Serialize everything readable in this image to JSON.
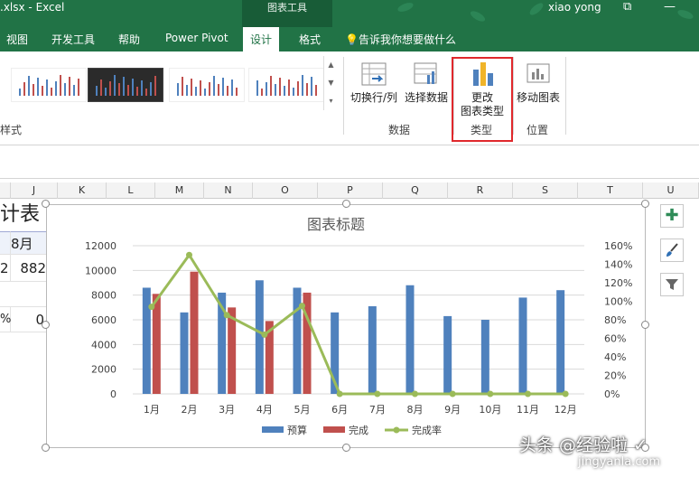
{
  "titlebar": {
    "file_title": ".xlsx  -  Excel",
    "context_tools": "图表工具",
    "user": "xiao yong",
    "restore_glyph": "⧉",
    "minimize_glyph": "—"
  },
  "tabs": [
    "视图",
    "开发工具",
    "帮助",
    "Power Pivot",
    "设计",
    "格式"
  ],
  "active_tab": "设计",
  "tell_me": "告诉我你想要做什么",
  "ribbon": {
    "styles_group_label": "样式",
    "buttons": {
      "switch_row_col": "切换行/列",
      "select_data": "选择数据",
      "change_chart_type_line1": "更改",
      "change_chart_type_line2": "图表类型",
      "move_chart": "移动图表"
    },
    "groups": {
      "data": "数据",
      "type": "类型",
      "location": "位置"
    }
  },
  "columns": [
    "J",
    "K",
    "L",
    "M",
    "N",
    "O",
    "P",
    "Q",
    "R",
    "S",
    "T",
    "U"
  ],
  "cells": {
    "title_fragment": "计表",
    "header_month": "8月",
    "num_left": "2",
    "num_right": "882",
    "pct_left": "%",
    "zero": "0"
  },
  "side_buttons": [
    "chart-elements",
    "chart-styles",
    "chart-filters"
  ],
  "colors": {
    "excel_green": "#217346",
    "budget": "#4f81bd",
    "done": "#c0504d",
    "rate": "#9bbb59",
    "highlight": "#e0282c"
  },
  "watermark": {
    "line1": "头条 @经验啦 ✓",
    "line2": "jingyanla.com"
  },
  "chart_data": {
    "type": "bar+line",
    "title": "图表标题",
    "categories": [
      "1月",
      "2月",
      "3月",
      "4月",
      "5月",
      "6月",
      "7月",
      "8月",
      "9月",
      "10月",
      "11月",
      "12月"
    ],
    "series": [
      {
        "name": "预算",
        "type": "bar",
        "axis": "left",
        "color": "#4f81bd",
        "values": [
          8600,
          6600,
          8200,
          9200,
          8600,
          6600,
          7100,
          8800,
          6300,
          6000,
          7800,
          8400
        ]
      },
      {
        "name": "完成",
        "type": "bar",
        "axis": "left",
        "color": "#c0504d",
        "values": [
          8100,
          9900,
          7000,
          5900,
          8200,
          0,
          0,
          0,
          0,
          0,
          0,
          0
        ]
      },
      {
        "name": "完成率",
        "type": "line",
        "axis": "right",
        "color": "#9bbb59",
        "values": [
          0.94,
          1.5,
          0.85,
          0.64,
          0.95,
          0,
          0,
          0,
          0,
          0,
          0,
          0
        ]
      }
    ],
    "ylim_left": [
      0,
      12000
    ],
    "yticks_left": [
      "0",
      "2000",
      "4000",
      "6000",
      "8000",
      "10000",
      "12000"
    ],
    "ylim_right": [
      0,
      1.6
    ],
    "yticks_right": [
      "0%",
      "20%",
      "40%",
      "60%",
      "80%",
      "100%",
      "120%",
      "140%",
      "160%"
    ],
    "grid": true,
    "legend": "bottom"
  }
}
